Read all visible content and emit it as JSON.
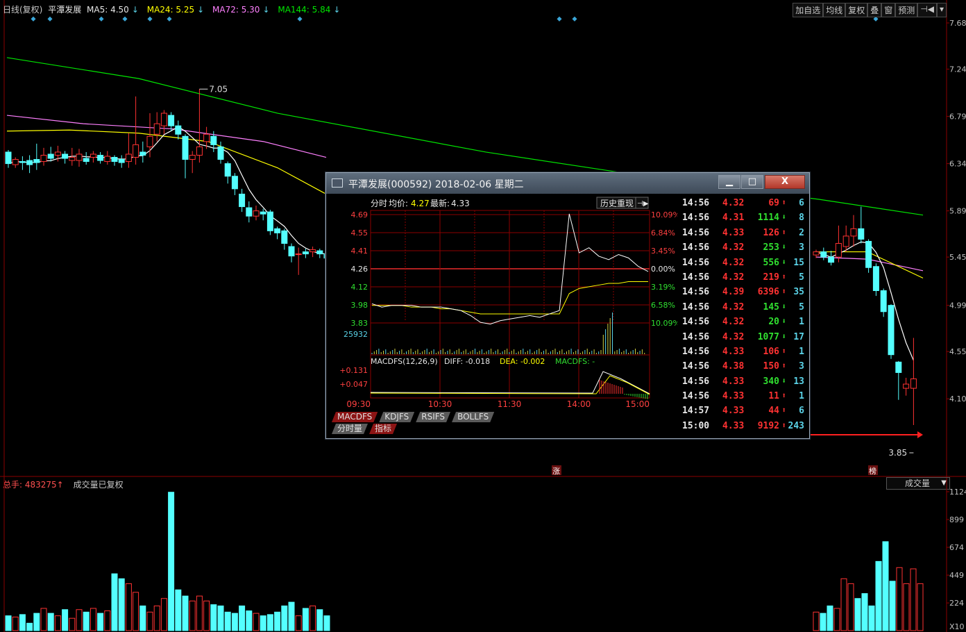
{
  "top_bar": {
    "period": "日线(复权)",
    "stock_name": "平潭发展",
    "ma5": "MA5: 4.50",
    "ma24": "MA24: 5.25",
    "ma72": "MA72: 5.30",
    "ma144": "MA144: 5.84",
    "arrow_down": "↓"
  },
  "toolbar": [
    "加自选",
    "均线",
    "复权",
    "叠",
    "窗",
    "预测",
    "⊣◀",
    "▾"
  ],
  "colors": {
    "up": "#ff3232",
    "down": "#54ffff",
    "ma5": "#ffffff",
    "ma24": "#ffff00",
    "ma72": "#ff80ff",
    "ma144": "#00e600",
    "grid": "#8b0000",
    "axis_text": "#c0c0c0"
  },
  "price_axis": [
    "7.68",
    "7.24",
    "6.79",
    "6.34",
    "5.89",
    "5.45",
    "4.99",
    "4.55",
    "4.10"
  ],
  "annotations": {
    "high": "7.05",
    "low": "3.85",
    "event_zhang": "涨",
    "event_bang": "榜"
  },
  "volume": {
    "label": "总手: 483275",
    "arrow_up": "↑",
    "note": "成交量已复权",
    "selector": "成交量",
    "axis": [
      "1124",
      "899",
      "674",
      "449",
      "224",
      "X10"
    ]
  },
  "chart_data": [
    {
      "type": "candlestick",
      "title": "平潭发展 日线(复权)",
      "ylim": [
        3.85,
        7.7
      ],
      "candles": [
        [
          6.45,
          6.34,
          6.3,
          6.47
        ],
        [
          6.33,
          6.38,
          6.3,
          6.4
        ],
        [
          6.36,
          6.35,
          6.28,
          6.41
        ],
        [
          6.37,
          6.33,
          6.25,
          6.42
        ],
        [
          6.38,
          6.35,
          6.28,
          6.53
        ],
        [
          6.36,
          6.42,
          6.32,
          6.49
        ],
        [
          6.43,
          6.39,
          6.36,
          6.5
        ],
        [
          6.42,
          6.45,
          6.36,
          6.51
        ],
        [
          6.43,
          6.39,
          6.34,
          6.46
        ],
        [
          6.37,
          6.4,
          6.32,
          6.49
        ],
        [
          6.37,
          6.43,
          6.31,
          6.48
        ],
        [
          6.39,
          6.36,
          6.33,
          6.45
        ],
        [
          6.4,
          6.43,
          6.35,
          6.46
        ],
        [
          6.42,
          6.37,
          6.34,
          6.45
        ],
        [
          6.36,
          6.41,
          6.33,
          6.46
        ],
        [
          6.4,
          6.36,
          6.32,
          6.42
        ],
        [
          6.38,
          6.35,
          6.3,
          6.42
        ],
        [
          6.36,
          6.43,
          6.3,
          6.63
        ],
        [
          6.4,
          6.52,
          6.33,
          6.98
        ],
        [
          6.45,
          6.42,
          6.35,
          6.55
        ],
        [
          6.5,
          6.6,
          6.4,
          6.82
        ],
        [
          6.62,
          6.72,
          6.55,
          6.83
        ],
        [
          6.7,
          6.82,
          6.62,
          6.85
        ],
        [
          6.8,
          6.7,
          6.65,
          6.83
        ],
        [
          6.7,
          6.62,
          6.57,
          6.75
        ],
        [
          6.6,
          6.38,
          6.2,
          6.62
        ],
        [
          6.38,
          6.42,
          6.25,
          6.46
        ],
        [
          6.42,
          6.5,
          6.35,
          7.05
        ],
        [
          6.55,
          6.62,
          6.48,
          6.69
        ],
        [
          6.6,
          6.52,
          6.45,
          6.65
        ],
        [
          6.5,
          6.38,
          6.34,
          6.55
        ],
        [
          6.34,
          6.22,
          6.15,
          6.36
        ],
        [
          6.22,
          6.1,
          6.04,
          6.25
        ],
        [
          6.05,
          5.93,
          5.88,
          6.1
        ],
        [
          5.92,
          5.84,
          5.78,
          5.98
        ],
        [
          5.84,
          5.89,
          5.8,
          5.94
        ],
        [
          5.88,
          5.86,
          5.8,
          5.91
        ],
        [
          5.88,
          5.7,
          5.66,
          5.9
        ],
        [
          5.72,
          5.68,
          5.62,
          5.74
        ],
        [
          5.7,
          5.58,
          5.52,
          5.72
        ],
        [
          5.55,
          5.46,
          5.4,
          5.58
        ],
        [
          5.48,
          5.48,
          5.28,
          5.54
        ],
        [
          5.5,
          5.48,
          5.44,
          5.53
        ],
        [
          5.5,
          5.52,
          5.45,
          5.55
        ],
        [
          5.51,
          5.48,
          5.44,
          5.53
        ],
        [
          5.48,
          5.44,
          5.4,
          5.5
        ]
      ],
      "candles_right": [
        [
          5.47,
          5.5,
          5.44,
          5.52
        ],
        [
          5.5,
          5.45,
          5.42,
          5.54
        ],
        [
          5.45,
          5.4,
          5.37,
          5.51
        ],
        [
          5.45,
          5.58,
          5.4,
          5.75
        ],
        [
          5.55,
          5.65,
          5.5,
          5.75
        ],
        [
          5.65,
          5.72,
          5.55,
          5.85
        ],
        [
          5.72,
          5.62,
          5.58,
          5.93
        ],
        [
          5.6,
          5.35,
          5.3,
          5.62
        ],
        [
          5.36,
          5.13,
          5.08,
          5.39
        ],
        [
          5.13,
          4.93,
          4.88,
          5.15
        ],
        [
          4.99,
          4.52,
          4.48,
          5.0
        ],
        [
          4.45,
          4.35,
          4.09,
          4.46
        ],
        [
          4.2,
          4.24,
          4.13,
          4.3
        ],
        [
          4.2,
          4.29,
          3.85,
          4.68
        ]
      ]
    },
    {
      "type": "bar",
      "title": "成交量",
      "ylim": [
        0,
        1124
      ],
      "values_left": [
        120,
        110,
        130,
        60,
        140,
        180,
        140,
        120,
        170,
        100,
        170,
        150,
        180,
        140,
        160,
        460,
        420,
        380,
        310,
        200,
        150,
        200,
        260,
        1120,
        330,
        280,
        240,
        280,
        240,
        210,
        200,
        150,
        140,
        200,
        160,
        140,
        120,
        130,
        150,
        200,
        230,
        120,
        180,
        200,
        170,
        120
      ],
      "values_right": [
        150,
        140,
        200,
        180,
        420,
        380,
        260,
        300,
        200,
        560,
        720,
        400,
        510,
        380,
        500,
        380
      ]
    }
  ],
  "popup": {
    "title": "平潭发展(000592) 2018-02-06 星期二",
    "min_btn": "▁",
    "max_btn": "□",
    "close_btn": "X",
    "header": "分时",
    "avg_label": "均价:",
    "avg_value": "4.27",
    "last_label": "最新:",
    "last_value": "4.33",
    "history_btn": "历史重现",
    "history_icon": "⊣▶",
    "price_labels": [
      "4.69",
      "4.55",
      "4.41",
      "4.26",
      "4.12",
      "3.98",
      "3.83"
    ],
    "pct_labels": [
      "10.09%",
      "6.84%",
      "3.45%",
      "0.00%",
      "3.19%",
      "6.58%",
      "10.09%"
    ],
    "volume_max": "25932",
    "macd_header": "MACDFS(12,26,9)",
    "diff": "DIFF: -0.018",
    "dea": "DEA: -0.002",
    "macd": "MACDFS: -",
    "macd_labels": [
      "+0.131",
      "+0.047"
    ],
    "time_labels": [
      "09:30",
      "10:30",
      "11:30",
      "14:00",
      "15:00"
    ],
    "tabs": [
      "MACDFS",
      "KDJFS",
      "RSIFS",
      "BOLLFS"
    ],
    "tabs2": [
      "分时量",
      "指标"
    ],
    "chart_data": {
      "type": "line",
      "title": "分时",
      "ylim": [
        3.83,
        4.69
      ],
      "price": [
        4.14,
        4.12,
        4.13,
        4.13,
        4.13,
        4.12,
        4.12,
        4.12,
        4.11,
        4.1,
        4.07,
        4.03,
        4.02,
        4.04,
        4.05,
        4.06,
        4.07,
        4.06,
        4.08,
        4.1,
        4.67,
        4.44,
        4.47,
        4.42,
        4.4,
        4.43,
        4.41,
        4.36,
        4.33
      ],
      "avg": [
        4.13,
        4.13,
        4.13,
        4.13,
        4.12,
        4.12,
        4.12,
        4.11,
        4.11,
        4.1,
        4.09,
        4.08,
        4.08,
        4.08,
        4.08,
        4.08,
        4.08,
        4.08,
        4.08,
        4.08,
        4.2,
        4.23,
        4.24,
        4.25,
        4.26,
        4.26,
        4.27,
        4.27,
        4.27
      ]
    },
    "ticks": [
      {
        "time": "14:56",
        "price": "4.32",
        "vol": "69",
        "dir": "up",
        "cnt": "6"
      },
      {
        "time": "14:56",
        "price": "4.31",
        "vol": "1114",
        "dir": "down",
        "cnt": "8"
      },
      {
        "time": "14:56",
        "price": "4.33",
        "vol": "126",
        "dir": "up",
        "cnt": "2"
      },
      {
        "time": "14:56",
        "price": "4.32",
        "vol": "253",
        "dir": "down",
        "cnt": "3"
      },
      {
        "time": "14:56",
        "price": "4.32",
        "vol": "556",
        "dir": "down",
        "cnt": "15"
      },
      {
        "time": "14:56",
        "price": "4.32",
        "vol": "219",
        "dir": "up",
        "cnt": "5"
      },
      {
        "time": "14:56",
        "price": "4.39",
        "vol": "6396",
        "dir": "up",
        "cnt": "35"
      },
      {
        "time": "14:56",
        "price": "4.32",
        "vol": "145",
        "dir": "down",
        "cnt": "5"
      },
      {
        "time": "14:56",
        "price": "4.32",
        "vol": "20",
        "dir": "down",
        "cnt": "1"
      },
      {
        "time": "14:56",
        "price": "4.32",
        "vol": "1077",
        "dir": "down",
        "cnt": "17"
      },
      {
        "time": "14:56",
        "price": "4.33",
        "vol": "106",
        "dir": "up",
        "cnt": "1"
      },
      {
        "time": "14:56",
        "price": "4.38",
        "vol": "150",
        "dir": "up",
        "cnt": "3"
      },
      {
        "time": "14:56",
        "price": "4.33",
        "vol": "340",
        "dir": "down",
        "cnt": "13"
      },
      {
        "time": "14:56",
        "price": "4.33",
        "vol": "11",
        "dir": "up",
        "cnt": "1"
      },
      {
        "time": "14:57",
        "price": "4.33",
        "vol": "44",
        "dir": "up",
        "cnt": "6"
      },
      {
        "time": "15:00",
        "price": "4.33",
        "vol": "9192",
        "dir": "up",
        "cnt": "243"
      }
    ]
  }
}
